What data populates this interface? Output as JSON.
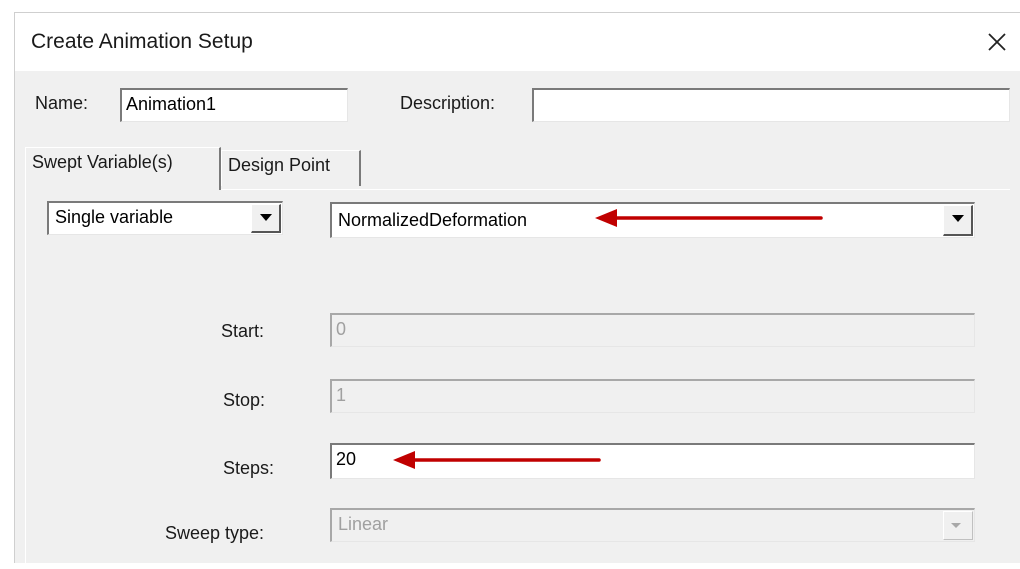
{
  "dialog": {
    "title": "Create Animation Setup",
    "close_icon": "close-icon"
  },
  "name": {
    "label": "Name:",
    "value": "Animation1"
  },
  "description": {
    "label": "Description:",
    "value": ""
  },
  "tabs": [
    {
      "label": "Swept Variable(s)",
      "active": true
    },
    {
      "label": "Design Point",
      "active": false
    }
  ],
  "sweep_mode": {
    "value": "Single variable"
  },
  "variable": {
    "value": "NormalizedDeformation"
  },
  "fields": {
    "start": {
      "label": "Start:",
      "value": "0",
      "disabled": true
    },
    "stop": {
      "label": "Stop:",
      "value": "1",
      "disabled": true
    },
    "steps": {
      "label": "Steps:",
      "value": "20",
      "disabled": false
    },
    "sweep_type": {
      "label": "Sweep type:",
      "value": "Linear",
      "disabled": true
    }
  },
  "colors": {
    "annotation_arrow": "#c00000",
    "dialog_bg": "#f0f0f0"
  }
}
